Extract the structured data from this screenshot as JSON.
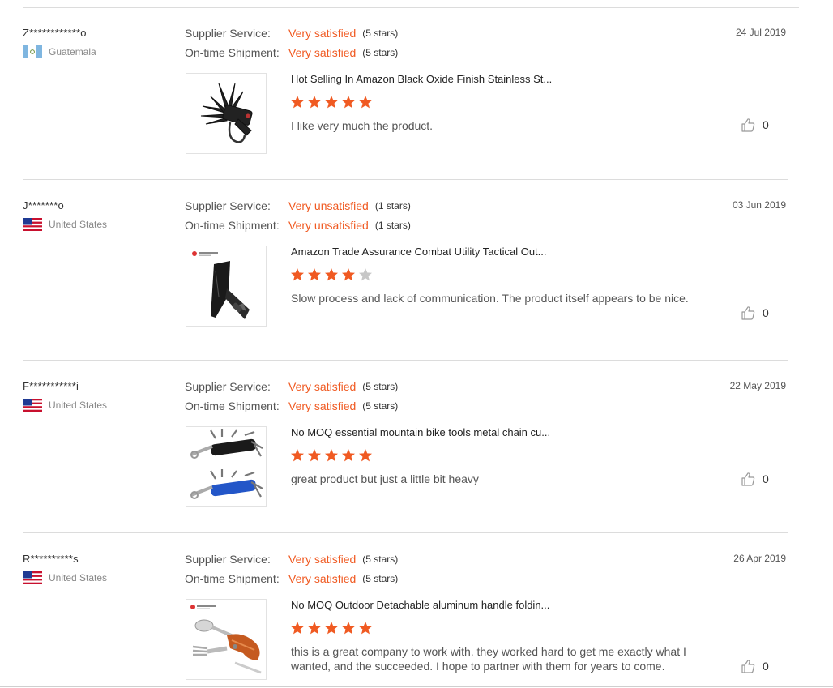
{
  "colors": {
    "accent": "#f05a22",
    "star_empty": "#c7c7c7"
  },
  "labels": {
    "supplier_service": "Supplier Service:",
    "on_time_shipment": "On-time Shipment:"
  },
  "reviews": [
    {
      "buyer": "Z************o",
      "country": "Guatemala",
      "flag_icon": "guatemala-flag-icon",
      "supplier_rating": "Very satisfied",
      "supplier_stars": "(5 stars)",
      "shipment_rating": "Very satisfied",
      "shipment_stars": "(5 stars)",
      "date": "24 Jul 2019",
      "product_image_icon": "multitool-black-icon",
      "product_title": "Hot Selling In Amazon Black Oxide Finish Stainless St...",
      "product_rating": 5,
      "comment": "I like very much the product.",
      "likes": "0"
    },
    {
      "buyer": "J*******o",
      "country": "United States",
      "flag_icon": "us-flag-icon",
      "supplier_rating": "Very unsatisfied",
      "supplier_stars": "(1 stars)",
      "shipment_rating": "Very unsatisfied",
      "shipment_stars": "(1 stars)",
      "date": "03 Jun 2019",
      "product_image_icon": "tactical-knife-icon",
      "product_title": "Amazon Trade Assurance Combat Utility Tactical Out...",
      "product_rating": 4,
      "comment": "Slow process and lack of communication. The product itself appears to be nice.",
      "likes": "0"
    },
    {
      "buyer": "F***********i",
      "country": "United States",
      "flag_icon": "us-flag-icon",
      "supplier_rating": "Very satisfied",
      "supplier_stars": "(5 stars)",
      "shipment_rating": "Very satisfied",
      "shipment_stars": "(5 stars)",
      "date": "22 May 2019",
      "product_image_icon": "bike-tool-icon",
      "product_title": "No MOQ essential mountain bike tools metal chain cu...",
      "product_rating": 5,
      "comment": "great product but just a little bit heavy",
      "likes": "0"
    },
    {
      "buyer": "R**********s",
      "country": "United States",
      "flag_icon": "us-flag-icon",
      "supplier_rating": "Very satisfied",
      "supplier_stars": "(5 stars)",
      "shipment_rating": "Very satisfied",
      "shipment_stars": "(5 stars)",
      "date": "26 Apr 2019",
      "product_image_icon": "camping-cutlery-icon",
      "product_title": "No MOQ Outdoor Detachable aluminum handle foldin...",
      "product_rating": 5,
      "comment": "this is a great company to work with.  they worked hard to get me exactly what I wanted,  and the succeeded.  I hope to partner with them for years to come.",
      "likes": "0"
    }
  ]
}
